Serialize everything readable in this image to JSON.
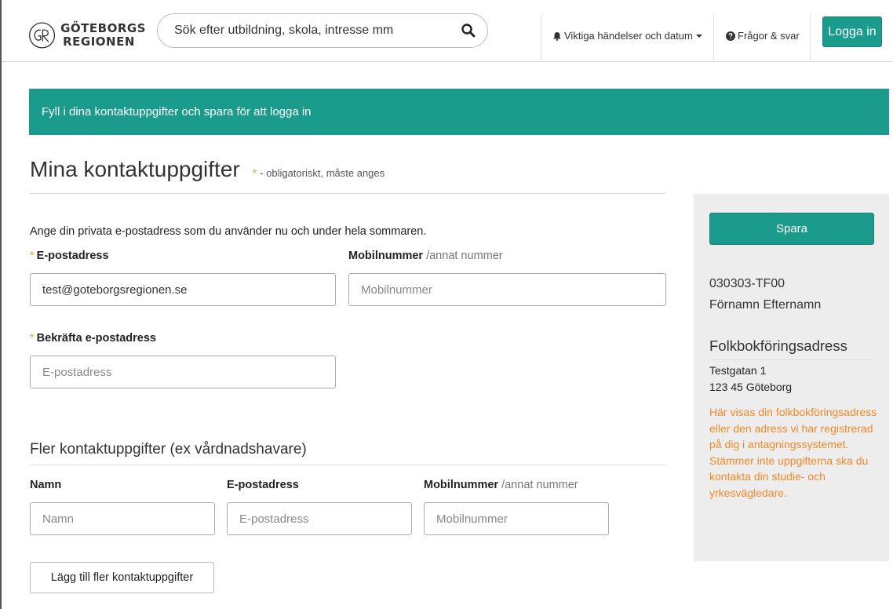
{
  "header": {
    "logo_line1": "GÖTEBORGS",
    "logo_line2": "REGIONEN",
    "search_placeholder": "Sök efter utbildning, skola, intresse mm",
    "events_label": "Viktiga händelser och datum",
    "faq_label": "Frågor & svar",
    "login_label": "Logga in"
  },
  "banner": {
    "text": "Fyll i dina kontaktuppgifter och spara för att logga in"
  },
  "page": {
    "title": "Mina kontaktuppgifter",
    "required_star": "*",
    "required_text": "- obligatoriskt, måste anges"
  },
  "form": {
    "intro": "Ange din privata e-postadress som du använder nu och under hela sommaren.",
    "email_star": "*",
    "email_label": "E-postadress",
    "email_value": "test@goteborgsregionen.se",
    "mobile_label": "Mobilnummer",
    "mobile_sub": "/annat nummer",
    "mobile_placeholder": "Mobilnummer",
    "confirm_star": "*",
    "confirm_label": "Bekräfta e-postadress",
    "confirm_placeholder": "E-postadress"
  },
  "more_contacts": {
    "title": "Fler kontaktuppgifter (ex vårdnadshavare)",
    "name_label": "Namn",
    "name_placeholder": "Namn",
    "email_label": "E-postadress",
    "email_placeholder": "E-postadress",
    "mobile_label": "Mobilnummer",
    "mobile_sub": "/annat nummer",
    "mobile_placeholder": "Mobilnummer",
    "add_button": "Lägg till fler kontaktuppgifter"
  },
  "sidebar": {
    "save_label": "Spara",
    "person_id": "030303-TF00",
    "person_name": "Förnamn Efternamn",
    "address_heading": "Folkbokföringsadress",
    "address_line1": "Testgatan 1",
    "address_line2": "123 45 Göteborg",
    "note": "Här visas din folkbokföringsadress eller den adress vi har registrerad på dig i antagningssystemet. Stämmer inte uppgifterna ska du kontakta din studie- och yrkesvägledare."
  },
  "colors": {
    "accent": "#1a9b8c",
    "required": "#f39c34",
    "note": "#f0892a"
  }
}
